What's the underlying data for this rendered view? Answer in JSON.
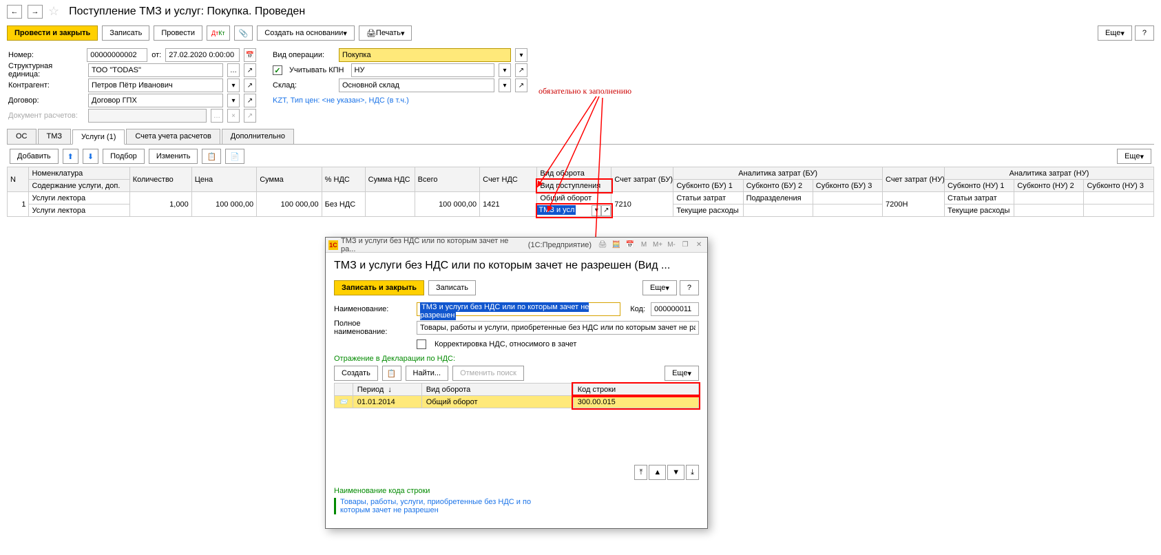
{
  "header": {
    "title": "Поступление ТМЗ и услуг: Покупка. Проведен"
  },
  "toolbar": {
    "post_close": "Провести и закрыть",
    "write": "Записать",
    "post": "Провести",
    "create_based": "Создать на основании",
    "print": "Печать",
    "more": "Еще",
    "help": "?"
  },
  "form": {
    "number_label": "Номер:",
    "number_value": "00000000002",
    "from_label": "от:",
    "date_value": "27.02.2020 0:00:00",
    "org_label": "Структурная единица:",
    "org_value": "ТОО \"TODAS\"",
    "counterparty_label": "Контрагент:",
    "counterparty_value": "Петров Пётр Иванович",
    "contract_label": "Договор:",
    "contract_value": "Договор ГПХ",
    "calc_doc_label": "Документ расчетов:",
    "calc_doc_value": "",
    "op_type_label": "Вид операции:",
    "op_type_value": "Покупка",
    "kpn_label": "Учитывать КПН",
    "kpn_value": "НУ",
    "warehouse_label": "Склад:",
    "warehouse_value": "Основной склад",
    "currency_note": "KZT, Тип цен: <не указан>, НДС (в т.ч.)"
  },
  "tabs": {
    "os": "ОС",
    "tmz": "ТМЗ",
    "services": "Услуги (1)",
    "accounts": "Счета учета расчетов",
    "extra": "Дополнительно"
  },
  "subtoolbar": {
    "add": "Добавить",
    "pick": "Подбор",
    "change": "Изменить",
    "more": "Еще"
  },
  "table": {
    "headers": {
      "n": "N",
      "nomen": "Номенклатура",
      "nomen2": "Содержание услуги, доп.",
      "qty": "Количество",
      "price": "Цена",
      "sum": "Сумма",
      "vat_pct": "% НДС",
      "vat_sum": "Сумма НДС",
      "total": "Всего",
      "vat_acc": "Счет НДС",
      "turnover": "Вид оборота",
      "income_type": "Вид поступления",
      "cost_acc_bu": "Счет затрат (БУ)",
      "analytics_bu": "Аналитика затрат (БУ)",
      "sub_bu1": "Субконто (БУ) 1",
      "sub_bu2": "Субконто (БУ) 2",
      "sub_bu3": "Субконто (БУ) 3",
      "cost_acc_nu": "Счет затрат (НУ)",
      "analytics_nu": "Аналитика затрат (НУ)",
      "sub_nu1": "Субконто (НУ) 1",
      "sub_nu2": "Субконто (НУ) 2",
      "sub_nu3": "Субконто (НУ) 3"
    },
    "row": {
      "n": "1",
      "nomen": "Услуги лектора",
      "nomen2": "Услуги лектора",
      "qty": "1,000",
      "price": "100 000,00",
      "sum": "100 000,00",
      "vat_pct": "Без НДС",
      "total": "100 000,00",
      "vat_acc": "1421",
      "turnover": "Общий оборот",
      "income_type": "ТМЗ и усл",
      "cost_acc_bu": "7210",
      "sub_bu1": "Статьи затрат",
      "sub_bu1_b": "Текущие расходы",
      "sub_bu2": "Подразделения",
      "cost_acc_nu": "7200Н",
      "sub_nu1": "Статьи затрат",
      "sub_nu1_b": "Текущие расходы"
    }
  },
  "annotation": "обязательно к заполнению",
  "modal": {
    "tb_title": "ТМЗ и услуги без НДС или по которым зачет не ра...",
    "tb_app": "(1С:Предприятие)",
    "title": "ТМЗ и услуги без НДС или по которым зачет не разрешен (Вид ...",
    "write_close": "Записать и закрыть",
    "write": "Записать",
    "more": "Еще",
    "help": "?",
    "name_label": "Наименование:",
    "name_value": "ТМЗ и услуги без НДС или по которым зачет не разрешен",
    "code_label": "Код:",
    "code_value": "000000011",
    "fullname_label": "Полное наименование:",
    "fullname_value": "Товары, работы и услуги, приобретенные без НДС или по которым зачет не разрешен",
    "vat_corr_label": "Корректировка НДС, относимого в зачет",
    "decl_section": "Отражение в Декларации по НДС:",
    "create": "Создать",
    "find": "Найти...",
    "cancel_search": "Отменить поиск",
    "decl_headers": {
      "period": "Период",
      "turnover": "Вид оборота",
      "line_code": "Код строки"
    },
    "decl_row": {
      "period": "01.01.2014",
      "turnover": "Общий оборот",
      "line_code": "300.00.015"
    },
    "footnote_title": "Наименование кода строки",
    "footnote": "Товары, работы, услуги, приобретенные без НДС и по которым зачет не разрешен"
  }
}
